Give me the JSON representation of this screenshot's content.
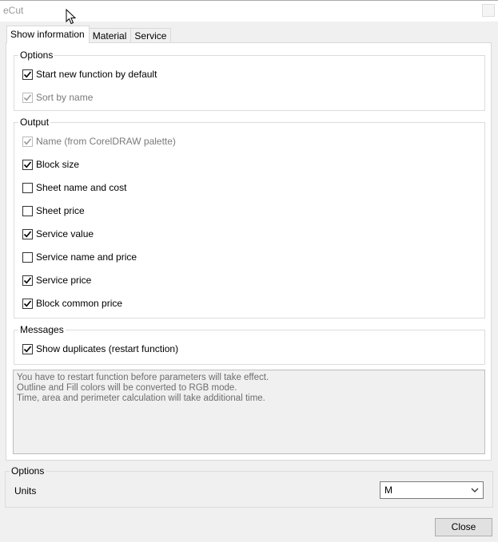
{
  "window": {
    "title": "eCut"
  },
  "tabs": [
    "Show information",
    "Material",
    "Service"
  ],
  "options_group": {
    "title": "Options",
    "items": [
      {
        "label": "Start new function by default",
        "checked": true,
        "enabled": true
      },
      {
        "label": "Sort by name",
        "checked": true,
        "enabled": false
      }
    ]
  },
  "output_group": {
    "title": "Output",
    "items": [
      {
        "label": "Name (from CorelDRAW palette)",
        "checked": true,
        "enabled": false
      },
      {
        "label": "Block size",
        "checked": true,
        "enabled": true
      },
      {
        "label": "Sheet name and cost",
        "checked": false,
        "enabled": true
      },
      {
        "label": "Sheet price",
        "checked": false,
        "enabled": true
      },
      {
        "label": "Service value",
        "checked": true,
        "enabled": true
      },
      {
        "label": "Service name and price",
        "checked": false,
        "enabled": true
      },
      {
        "label": "Service price",
        "checked": true,
        "enabled": true
      },
      {
        "label": "Block common price",
        "checked": true,
        "enabled": true
      }
    ]
  },
  "messages_group": {
    "title": "Messages",
    "items": [
      {
        "label": "Show duplicates (restart function)",
        "checked": true,
        "enabled": true
      }
    ]
  },
  "info_lines": [
    "You have to restart function before parameters will take effect.",
    "Outline and Fill colors will be converted to RGB mode.",
    "Time, area and perimeter calculation will take additional time."
  ],
  "bottom_options": {
    "title": "Options",
    "units_label": "Units",
    "units_value": "M"
  },
  "close_label": "Close"
}
